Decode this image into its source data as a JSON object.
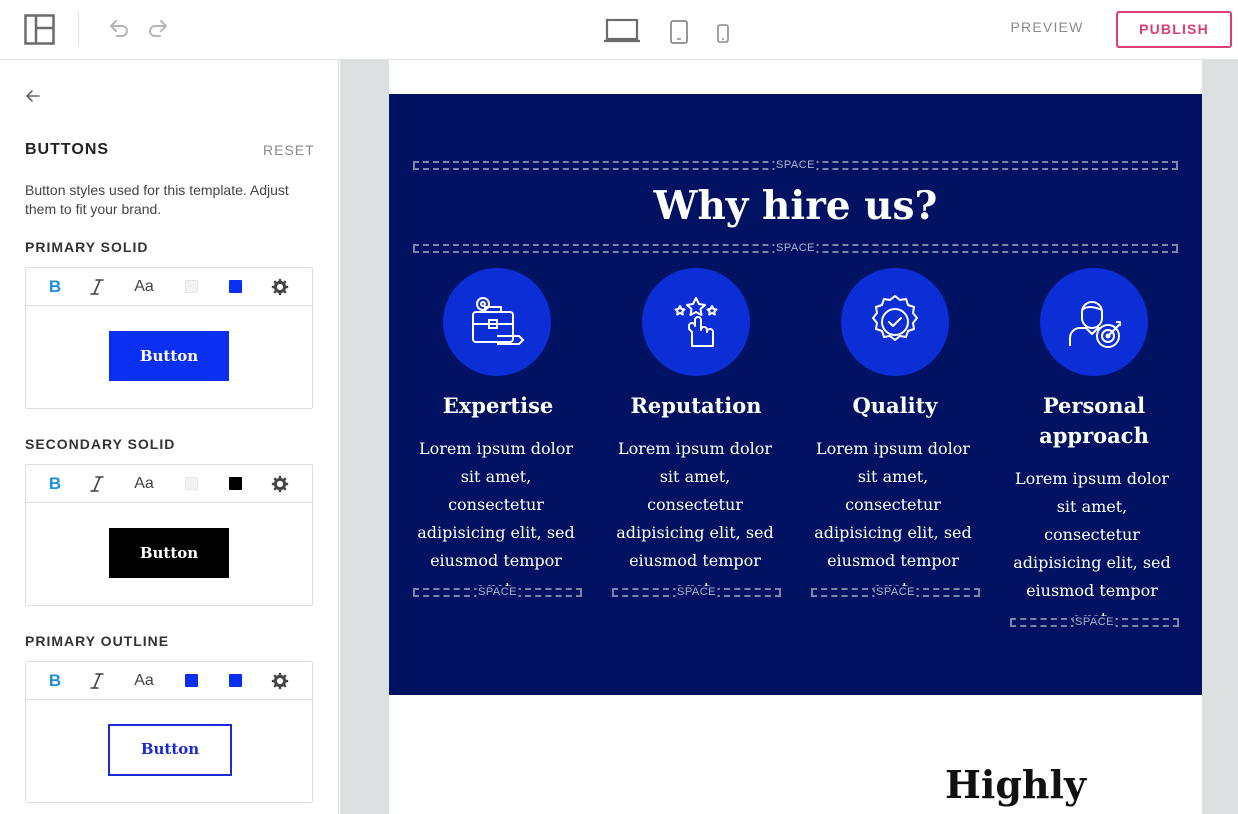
{
  "topbar": {
    "preview_label": "PREVIEW",
    "publish_label": "PUBLISH",
    "icons": [
      "layout-icon",
      "undo-icon",
      "redo-icon",
      "desktop-icon",
      "tablet-icon",
      "mobile-icon"
    ]
  },
  "sidebar": {
    "title": "BUTTONS",
    "reset_label": "RESET",
    "description": "Button styles used for this template. Adjust them to fit your brand.",
    "groups": [
      {
        "label": "PRIMARY SOLID",
        "bold": "B",
        "size": "Aa",
        "text_color": "#f2f2f2",
        "bg_color": "#0b2ef3",
        "button_label": "Button"
      },
      {
        "label": "SECONDARY SOLID",
        "bold": "B",
        "size": "Aa",
        "text_color": "#f2f2f2",
        "bg_color": "#000000",
        "button_label": "Button"
      },
      {
        "label": "PRIMARY OUTLINE",
        "bold": "B",
        "size": "Aa",
        "text_color": "#0b2ef3",
        "bg_color": "#0b2ef3",
        "button_label": "Button"
      }
    ]
  },
  "canvas": {
    "hero_title": "Why hire us?",
    "space_label": "SPACE",
    "features": [
      {
        "title": "Expertise",
        "text": "Lorem ipsum dolor sit amet, consectetur adipisicing elit, sed eiusmod tempor eget.",
        "icon": "briefcase-icon"
      },
      {
        "title": "Reputation",
        "text": "Lorem ipsum dolor sit amet, consectetur adipisicing elit, sed eiusmod tempor eget.",
        "icon": "stars-hand-icon"
      },
      {
        "title": "Quality",
        "text": "Lorem ipsum dolor sit amet, consectetur adipisicing elit, sed eiusmod tempor eget.",
        "icon": "quality-badge-icon"
      },
      {
        "title": "Personal approach",
        "text": "Lorem ipsum dolor sit amet, consectetur adipisicing elit, sed eiusmod tempor eget.",
        "icon": "person-target-icon"
      }
    ],
    "next_heading": "Highly"
  },
  "colors": {
    "hero_bg": "#001261",
    "accent": "#0b2ed7",
    "publish": "#dc3d76"
  }
}
